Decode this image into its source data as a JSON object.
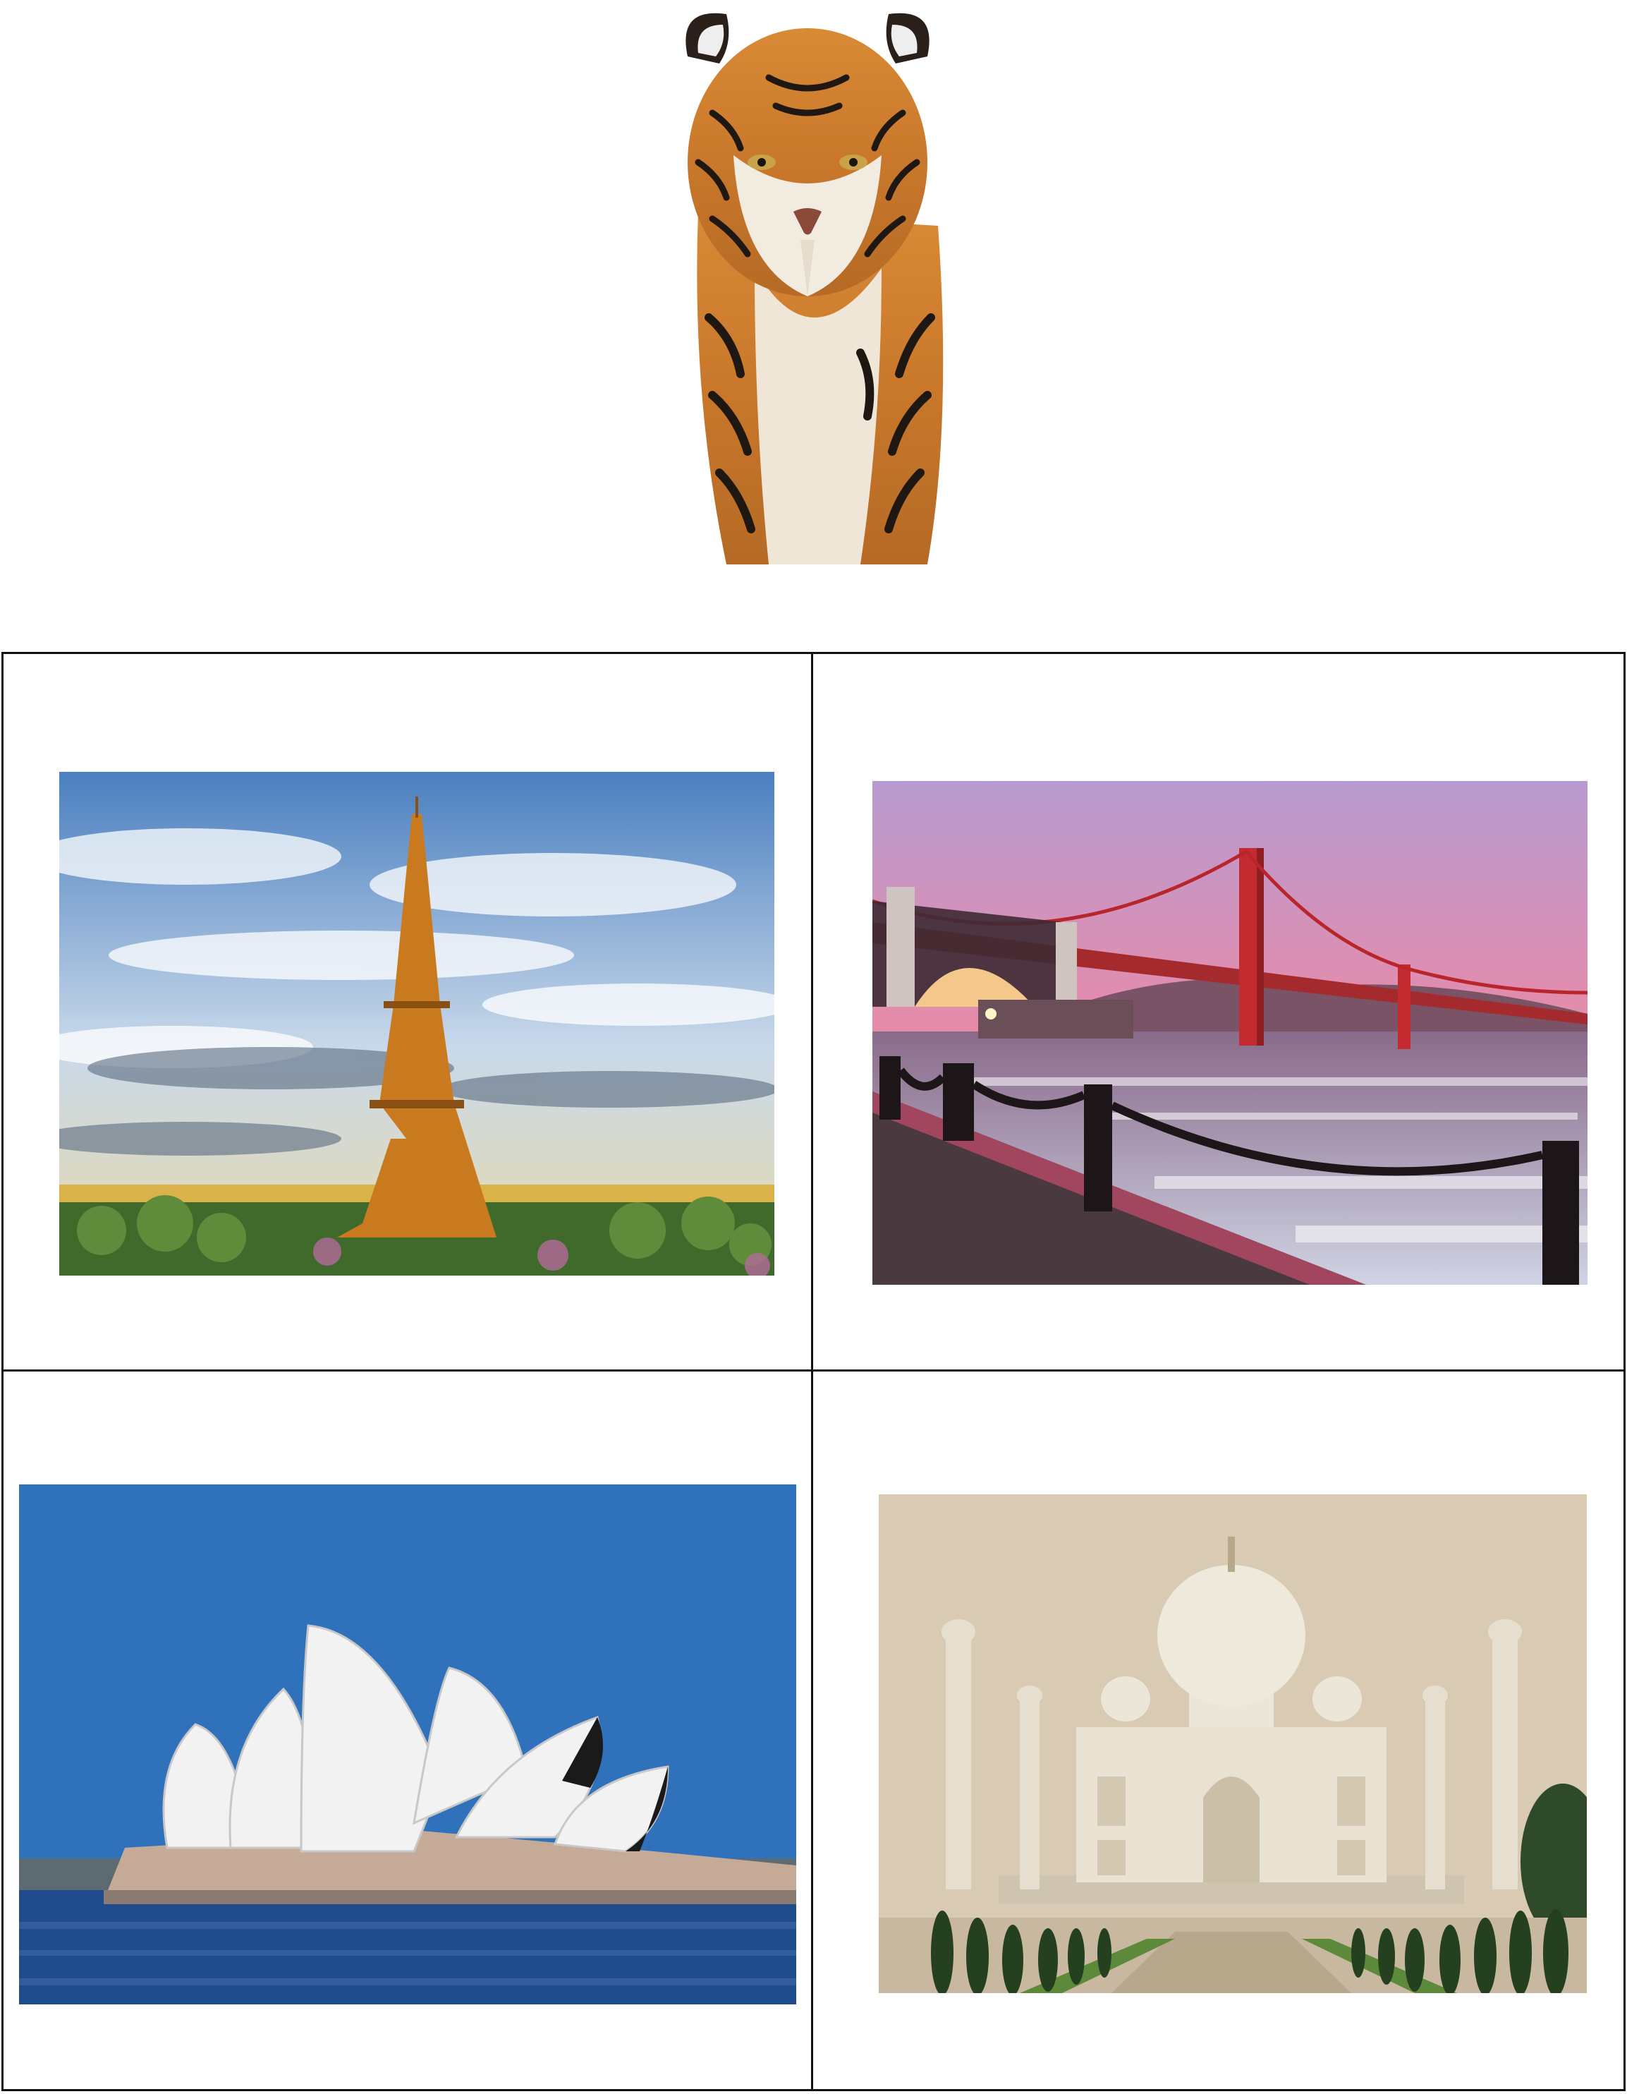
{
  "images": [
    {
      "subject": "tiger"
    },
    {
      "subject": "eiffel-tower"
    },
    {
      "subject": "golden-gate-bridge"
    },
    {
      "subject": "sydney-opera-house"
    },
    {
      "subject": "taj-mahal"
    }
  ],
  "colors": {
    "border": "#111111",
    "tiger_orange": "#c97a2c",
    "paris_sky": "#4f88c8",
    "sunset_pink": "#e58aa8",
    "bridge_red": "#c0282d",
    "opera_sky": "#2f74bc",
    "taj_sky": "#d9cbb3"
  }
}
